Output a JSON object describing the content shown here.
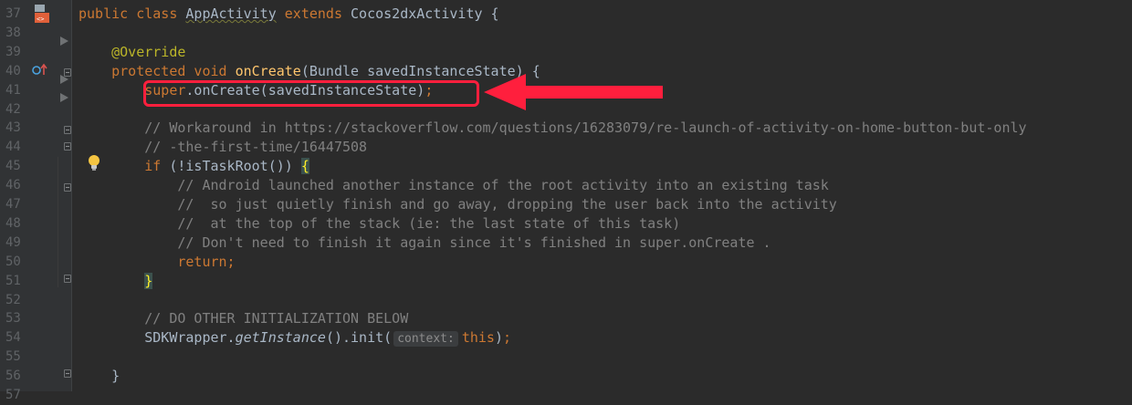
{
  "editor": {
    "lines": [
      {
        "n": "37",
        "segments": [
          {
            "t": "public class ",
            "c": "kw"
          },
          {
            "t": "AppActivity",
            "c": "underline"
          },
          {
            "t": " extends ",
            "c": "kw"
          },
          {
            "t": "Cocos2dxActivity {",
            "c": "plain"
          }
        ]
      },
      {
        "n": "38",
        "segments": []
      },
      {
        "n": "39",
        "segments": [
          {
            "t": "    @Override",
            "c": "ann"
          }
        ]
      },
      {
        "n": "40",
        "segments": [
          {
            "t": "    protected void ",
            "c": "kw"
          },
          {
            "t": "onCreate",
            "c": "fn"
          },
          {
            "t": "(Bundle savedInstanceState) {",
            "c": "plain"
          }
        ]
      },
      {
        "n": "41",
        "segments": [
          {
            "t": "        ",
            "c": "plain"
          },
          {
            "t": "super",
            "c": "kw"
          },
          {
            "t": ".onCreate(savedInstanceState)",
            "c": "plain"
          },
          {
            "t": ";",
            "c": "kw"
          }
        ]
      },
      {
        "n": "42",
        "segments": []
      },
      {
        "n": "43",
        "segments": [
          {
            "t": "        // Workaround in https://stackoverflow.com/questions/16283079/re-launch-of-activity-on-home-button-but-only",
            "c": "cm"
          }
        ]
      },
      {
        "n": "44",
        "segments": [
          {
            "t": "        // -the-first-time/16447508",
            "c": "cm"
          }
        ]
      },
      {
        "n": "45",
        "segments": [
          {
            "t": "        ",
            "c": "plain"
          },
          {
            "t": "if ",
            "c": "kw"
          },
          {
            "t": "(!isTaskRoot()) ",
            "c": "plain"
          },
          {
            "t": "{",
            "c": "match"
          }
        ]
      },
      {
        "n": "46",
        "segments": [
          {
            "t": "            // Android launched another instance of the root activity into an existing task",
            "c": "cm"
          }
        ]
      },
      {
        "n": "47",
        "segments": [
          {
            "t": "            //  so just quietly finish and go away, dropping the user back into the activity",
            "c": "cm"
          }
        ]
      },
      {
        "n": "48",
        "segments": [
          {
            "t": "            //  at the top of the stack (ie: the last state of this task)",
            "c": "cm"
          }
        ]
      },
      {
        "n": "49",
        "segments": [
          {
            "t": "            // Don't need to finish it again since it's finished in super.onCreate .",
            "c": "cm"
          }
        ]
      },
      {
        "n": "50",
        "segments": [
          {
            "t": "            ",
            "c": "plain"
          },
          {
            "t": "return;",
            "c": "kw"
          }
        ]
      },
      {
        "n": "51",
        "segments": [
          {
            "t": "        ",
            "c": "plain"
          },
          {
            "t": "}",
            "c": "match"
          }
        ]
      },
      {
        "n": "52",
        "segments": []
      },
      {
        "n": "53",
        "segments": [
          {
            "t": "        // DO OTHER INITIALIZATION BELOW",
            "c": "cm"
          }
        ]
      },
      {
        "n": "54",
        "segments": [
          {
            "t": "        SDKWrapper.",
            "c": "plain"
          },
          {
            "t": "getInstance",
            "c": "it"
          },
          {
            "t": "().init(",
            "c": "plain"
          },
          {
            "t": "context:",
            "c": "hint"
          },
          {
            "t": "this",
            "c": "kw"
          },
          {
            "t": ")",
            "c": "plain"
          },
          {
            "t": ";",
            "c": "kw"
          }
        ]
      },
      {
        "n": "55",
        "segments": []
      },
      {
        "n": "56",
        "segments": [
          {
            "t": "    }",
            "c": "plain"
          }
        ]
      },
      {
        "n": "57",
        "segments": []
      }
    ]
  },
  "colors": {
    "background": "#2b2b2b",
    "gutter": "#313335",
    "keyword": "#cc7832",
    "annotation": "#bbb529",
    "method": "#ffc66d",
    "comment": "#808080",
    "highlight": "#ff1f3d"
  },
  "icons": [
    "java-file-icon",
    "override-method-icon",
    "lightbulb-icon",
    "fold-icon",
    "arrow-annotation"
  ]
}
